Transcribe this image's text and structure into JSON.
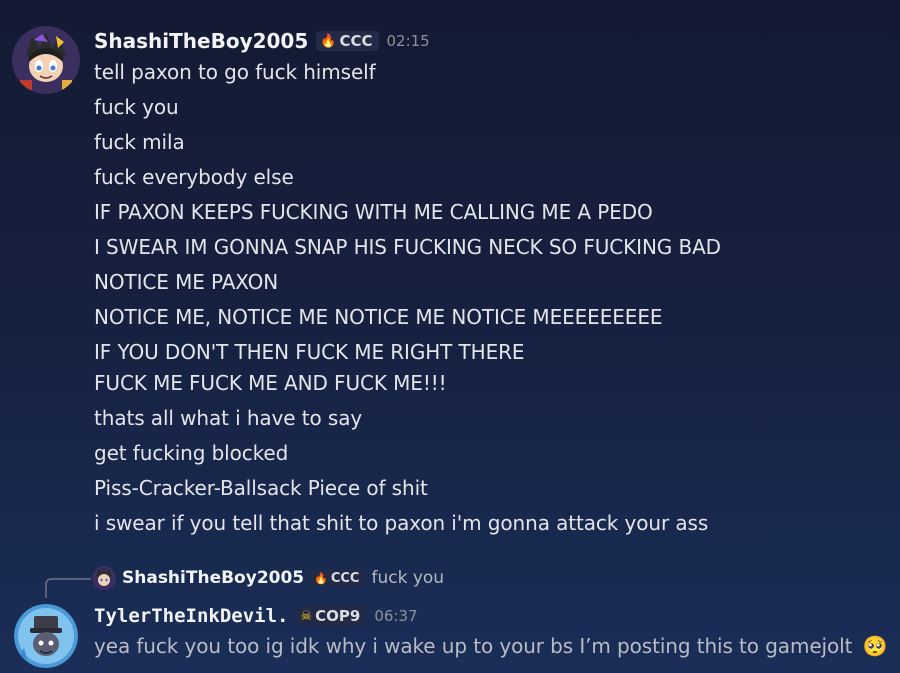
{
  "messages": [
    {
      "username": "ShashiTheBoy2005",
      "tag": "CCC",
      "tag_icon": "flame-icon",
      "timestamp": "02:15",
      "lines": [
        "tell paxon to go fuck himself",
        "fuck you",
        "fuck mila",
        "fuck everybody else",
        "IF PAXON KEEPS FUCKING WITH ME CALLING ME A PEDO",
        "I SWEAR IM GONNA SNAP HIS FUCKING NECK SO FUCKING BAD",
        "NOTICE ME PAXON",
        "NOTICE ME, NOTICE ME NOTICE ME NOTICE MEEEEEEEEE",
        "IF YOU DON'T THEN FUCK ME RIGHT THERE",
        "FUCK ME FUCK ME AND FUCK ME!!!",
        "thats all what i have to say",
        "get fucking blocked",
        "Piss-Cracker-Ballsack Piece of shit",
        "i swear if you tell that shit to paxon i'm gonna attack your ass"
      ]
    },
    {
      "reply_to": {
        "username": "ShashiTheBoy2005",
        "tag": "CCC",
        "text": "fuck you"
      },
      "username": "TylerTheInkDevil.",
      "tag": "COP9",
      "tag_icon": "skull-icon",
      "timestamp": "06:37",
      "text": "yea fuck you too ig idk why i wake up to your bs I’m posting this to gamejolt",
      "emoji": "🥺"
    }
  ]
}
